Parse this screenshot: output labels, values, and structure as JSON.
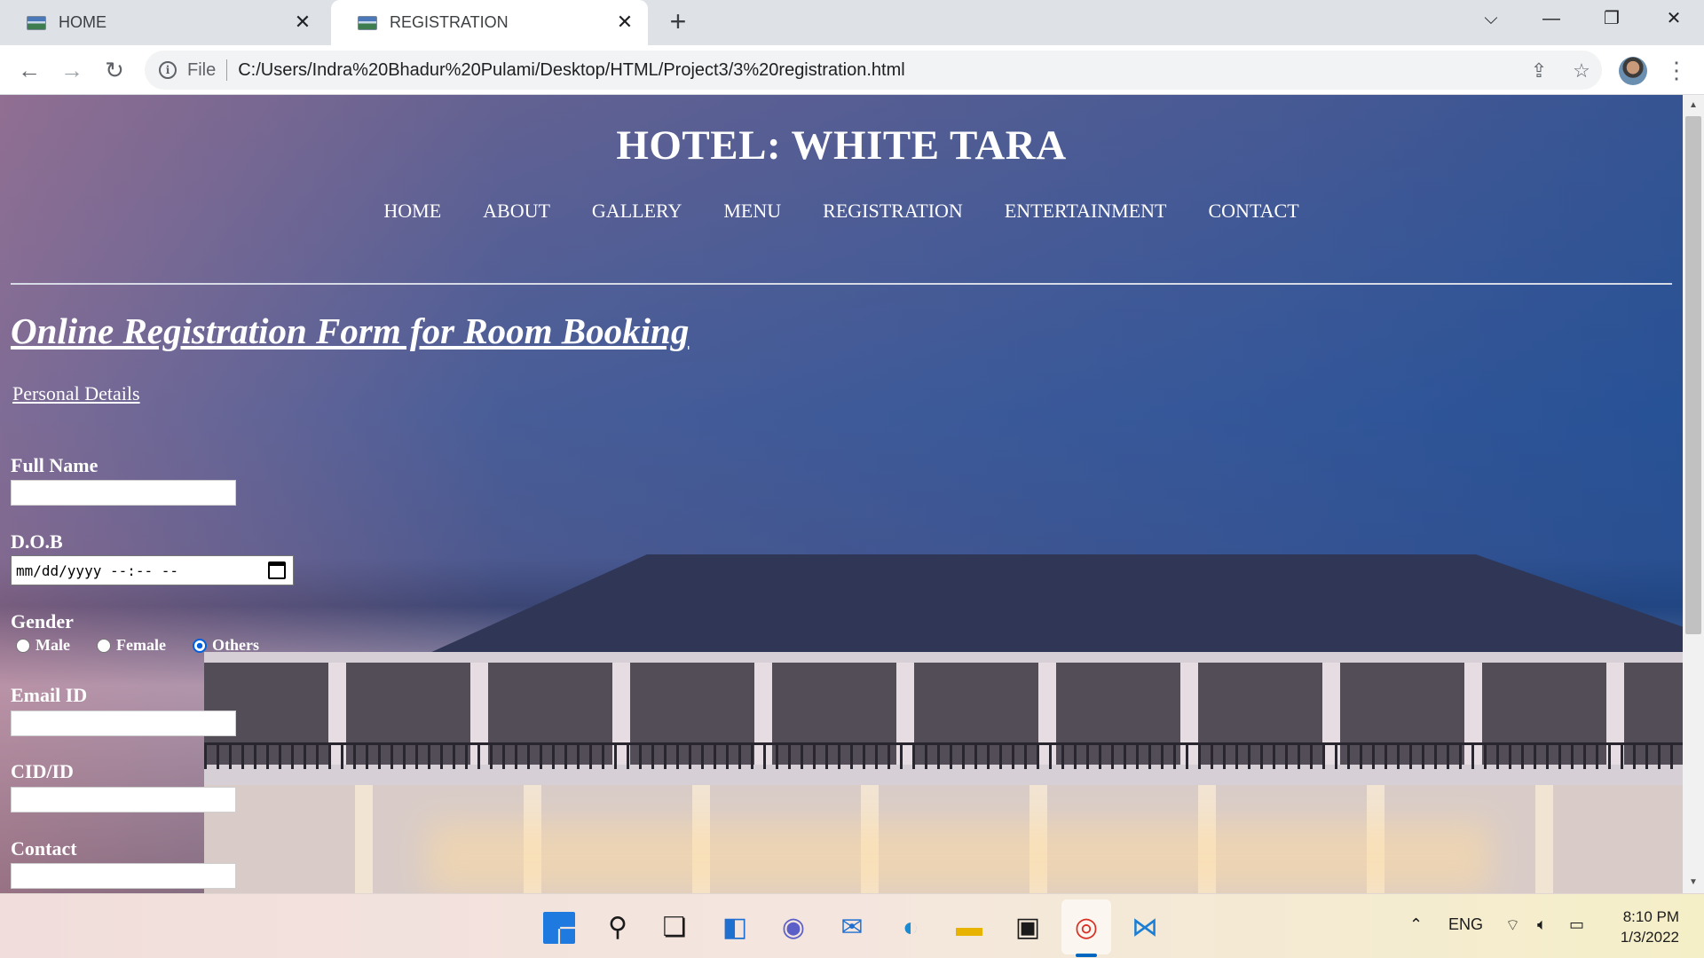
{
  "browser": {
    "tabs": [
      {
        "title": "HOME",
        "active": false
      },
      {
        "title": "REGISTRATION",
        "active": true
      }
    ],
    "address": {
      "scheme_label": "File",
      "url": "C:/Users/Indra%20Bhadur%20Pulami/Desktop/HTML/Project3/3%20registration.html"
    },
    "icons": [
      "back-icon",
      "forward-icon",
      "reload-icon",
      "info-icon",
      "share-icon",
      "star-icon",
      "profile-avatar",
      "menu-icon",
      "new-tab-icon",
      "tab-search-icon",
      "minimize-icon",
      "restore-icon",
      "close-icon"
    ]
  },
  "page": {
    "hotel_title": "HOTEL: WHITE TARA",
    "nav": [
      "HOME",
      "ABOUT",
      "GALLERY",
      "MENU",
      "REGISTRATION",
      "ENTERTAINMENT",
      "CONTACT"
    ],
    "form_title": "Online Registration Form for Room Booking",
    "section": "Personal Details",
    "fields": {
      "full_name": {
        "label": "Full Name",
        "value": ""
      },
      "dob": {
        "label": "D.O.B",
        "placeholder_text": "mm/dd/yyyy --:-- --"
      },
      "gender": {
        "label": "Gender",
        "options": [
          "Male",
          "Female",
          "Others"
        ],
        "selected": "Others"
      },
      "email": {
        "label": "Email ID",
        "value": ""
      },
      "cid": {
        "label": "CID/ID",
        "value": ""
      },
      "contact": {
        "label": "Contact",
        "value": ""
      }
    }
  },
  "taskbar": {
    "apps": [
      "start",
      "search",
      "task-view",
      "widgets",
      "teams-chat",
      "mail",
      "edge",
      "file-explorer",
      "terminal",
      "chrome",
      "vscode"
    ],
    "active_app": "chrome",
    "tray": {
      "language": "ENG"
    },
    "clock": {
      "time": "8:10 PM",
      "date": "1/3/2022"
    }
  },
  "colors": {
    "tab_strip": "#dee1e6",
    "text_white": "#ffffff",
    "accent_blue": "#0060df"
  }
}
